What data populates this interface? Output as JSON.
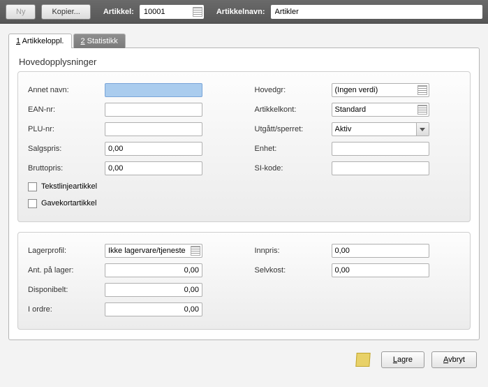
{
  "header": {
    "ny_label": "Ny",
    "kopier_label": "Kopier...",
    "artikkel_label": "Artikkel:",
    "artikkel_value": "10001",
    "artikkelnavn_label": "Artikkelnavn:",
    "artikkelnavn_value": "Artikler"
  },
  "tabs": {
    "t1_num": "1",
    "t1_label": " Artikkeloppl.",
    "t2_num": "2",
    "t2_label": " Statistikk"
  },
  "section1_title": "Hovedopplysninger",
  "left1": {
    "annet_navn_lbl": "Annet navn:",
    "annet_navn_val": "",
    "ean_lbl": "EAN-nr:",
    "ean_val": "",
    "plu_lbl": "PLU-nr:",
    "plu_val": "",
    "salgspris_lbl": "Salgspris:",
    "salgspris_val": "0,00",
    "bruttopris_lbl": "Bruttopris:",
    "bruttopris_val": "0,00",
    "tekstlinje_lbl": "Tekstlinjeartikkel",
    "gavekort_lbl": "Gavekortartikkel"
  },
  "right1": {
    "hovedgr_lbl": "Hovedgr:",
    "hovedgr_val": "(Ingen verdi)",
    "artikkelkont_lbl": "Artikkelkont:",
    "artikkelkont_val": "Standard",
    "utgatt_lbl": "Utgått/sperret:",
    "utgatt_val": "Aktiv",
    "enhet_lbl": "Enhet:",
    "enhet_val": "",
    "sikode_lbl": "SI-kode:",
    "sikode_val": ""
  },
  "left2": {
    "lagerprofil_lbl": "Lagerprofil:",
    "lagerprofil_val": "Ikke lagervare/tjeneste",
    "antlager_lbl": "Ant. på lager:",
    "antlager_val": "0,00",
    "disponibelt_lbl": "Disponibelt:",
    "disponibelt_val": "0,00",
    "iordre_lbl": "I ordre:",
    "iordre_val": "0,00"
  },
  "right2": {
    "innpris_lbl": "Innpris:",
    "innpris_val": "0,00",
    "selvkost_lbl": "Selvkost:",
    "selvkost_val": "0,00"
  },
  "footer": {
    "lagre_u": "L",
    "lagre_rest": "agre",
    "avbryt_u": "A",
    "avbryt_rest": "vbryt"
  }
}
